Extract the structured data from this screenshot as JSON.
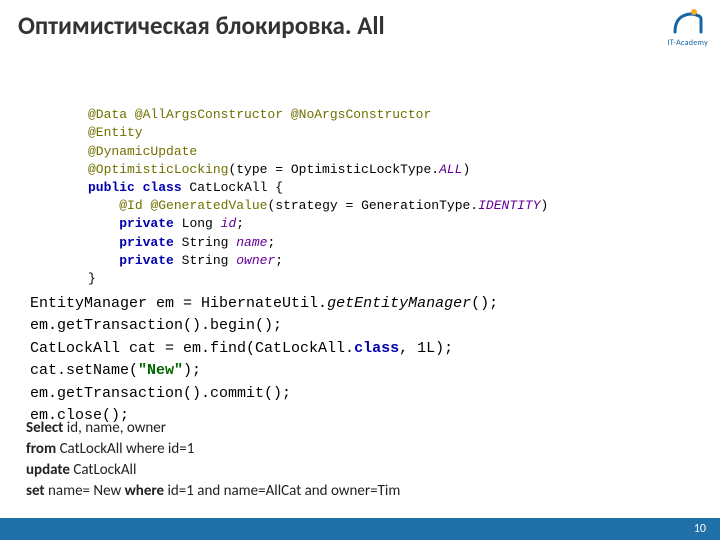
{
  "title": "Оптимистическая блокировка. All",
  "logo_text": "IT-Academy",
  "code1": {
    "l1a": "@Data ",
    "l1b": "@AllArgsConstructor ",
    "l1c": "@NoArgsConstructor",
    "l2": "@Entity",
    "l3": "@DynamicUpdate",
    "l4a": "@OptimisticLocking",
    "l4b": "(type = OptimisticLockType.",
    "l4c": "ALL",
    "l4d": ")",
    "l5a": "public class ",
    "l5b": "CatLockAll {",
    "l6a": "@Id ",
    "l6b": "@GeneratedValue",
    "l6c": "(strategy = GenerationType.",
    "l6d": "IDENTITY",
    "l6e": ")",
    "l7a": "private ",
    "l7b": "Long ",
    "l7c": "id",
    "l7d": ";",
    "l8a": "private ",
    "l8b": "String ",
    "l8c": "name",
    "l8d": ";",
    "l9a": "private ",
    "l9b": "String ",
    "l9c": "owner",
    "l9d": ";",
    "l10": "}"
  },
  "code2": {
    "l1a": "EntityManager em = HibernateUtil.",
    "l1b": "getEntityManager",
    "l1c": "();",
    "l2": "em.getTransaction().begin();",
    "l3a": "CatLockAll cat = em.find(CatLockAll.",
    "l3b": "class",
    "l3c": ", 1L);",
    "l4a": "cat.setName(",
    "l4b": "\"New\"",
    "l4c": ");",
    "l5": "em.getTransaction().commit();",
    "l6": "em.close();"
  },
  "sql": {
    "l1a": "Select ",
    "l1b": "id, name, owner",
    "l2a": "from ",
    "l2b": "CatLockAll  where id=1",
    "l3a": "update ",
    "l3b": "CatLockAll",
    "l4a": " set ",
    "l4b": "name= New ",
    "l4c": "where ",
    "l4d": "id=1 and name=AllCat and owner=Tim"
  },
  "page_number": "10"
}
